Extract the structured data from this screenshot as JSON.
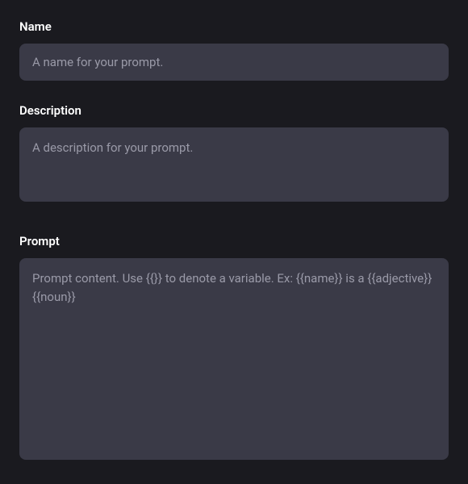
{
  "form": {
    "name": {
      "label": "Name",
      "placeholder": "A name for your prompt.",
      "value": ""
    },
    "description": {
      "label": "Description",
      "placeholder": "A description for your prompt.",
      "value": ""
    },
    "prompt": {
      "label": "Prompt",
      "placeholder": "Prompt content. Use {{}} to denote a variable. Ex: {{name}} is a {{adjective}} {{noun}}",
      "value": ""
    }
  }
}
